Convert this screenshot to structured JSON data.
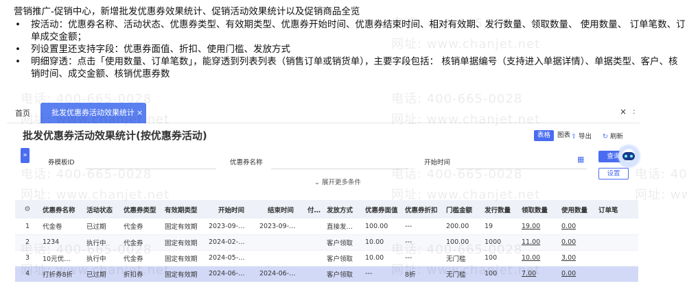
{
  "notes": {
    "intro": "营销推广-促销中心，新增批发优惠券效果统计、促销活动效果统计以及促销商品全览",
    "bullets": [
      "按活动：优惠券名称、活动状态、优惠券类型、有效期类型、优惠券开始时间、优惠券结束时间、相对有效期、发行数量、领取数量、 使用数量、 订单笔数、订单成交金额；",
      "列设置里还支持字段：优惠券面值、折扣、使用门槛、发放方式",
      "明细穿透：点击「使用数量、订单笔数」，能穿透到列表列表（销售订单或销货单），主要字段包括： 核销单据编号（支持进入单据详情）、单据类型、客户、核销时间、成交金额、核销优惠券数"
    ],
    "bullet_symbol": "•"
  },
  "watermark": {
    "phone": "电话: 400-665-0028",
    "site": "网址: www.chanjet.net"
  },
  "tabs": {
    "home": "首页",
    "active": "批发优惠券活动效果统计",
    "close_symbol": "×"
  },
  "window": {
    "close_symbol": "×",
    "extra": ":"
  },
  "page": {
    "title": "批发优惠券活动效果统计(按优惠券活动)",
    "view_table": "表格",
    "view_chart": "图表",
    "export": "导出",
    "refresh": "刷新"
  },
  "filters": {
    "expand_symbol": "»",
    "field1": "券模板ID",
    "field2": "优惠券名称",
    "field3": "开始时间",
    "query": "查询",
    "settings": "设置",
    "more": "展开更多条件"
  },
  "table": {
    "columns": [
      "",
      "优惠券名称",
      "活动状态",
      "优惠券类型",
      "有效期类型",
      "开始时间",
      "结束时间",
      "付有效",
      "发放方式",
      "优惠券面值",
      "优惠券折扣",
      "门槛金额",
      "发行数量",
      "领取数量",
      "使用数量",
      "订单笔"
    ],
    "rows": [
      [
        "1",
        "代金卷",
        "已过期",
        "代金券",
        "固定有效期",
        "2023-09-…",
        "2023-09-…",
        "",
        "直接发…",
        "100.00",
        "---",
        "200.00",
        "19",
        "19.00",
        "0.00",
        ""
      ],
      [
        "2",
        "1234",
        "执行中",
        "代金券",
        "固定有效期",
        "2024-02-…",
        "",
        "",
        "客户领取",
        "10.00",
        "---",
        "100.00",
        "1000",
        "11.00",
        "0.00",
        ""
      ],
      [
        "3",
        "10元优…",
        "执行中",
        "代金券",
        "固定有效期",
        "2024-05-…",
        "",
        "",
        "客户领取",
        "10.00",
        "---",
        "无门槛",
        "100",
        "10.00",
        "3.00",
        ""
      ],
      [
        "4",
        "打折券8折",
        "已过期",
        "折扣券",
        "固定有效期",
        "2024-06-…",
        "2024-06-…",
        "",
        "客户领取",
        "---",
        "8折",
        "无门槛",
        "100",
        "7.00",
        "0.00",
        ""
      ]
    ],
    "selected_row": 4
  },
  "colors": {
    "accent": "#4a6cf0",
    "tab_active": "#5a7ff0",
    "header_bg": "#eef1f7",
    "selected_row": "#d2d9f7"
  },
  "icons": [
    "gear-icon",
    "export-icon",
    "refresh-icon",
    "calendar-icon",
    "chevron-down-icon",
    "close-icon",
    "assistant-robot-icon"
  ]
}
